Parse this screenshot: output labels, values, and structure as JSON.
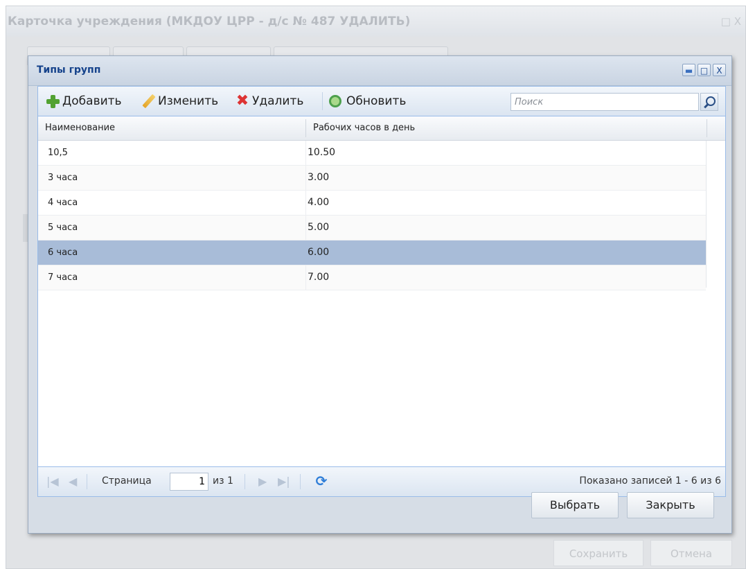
{
  "background_window": {
    "title": "Карточка учреждения (МКДОУ ЦРР - д/с № 487 УДАЛИТЬ)",
    "controls": "□ X",
    "save_label": "Сохранить",
    "cancel_label": "Отмена"
  },
  "dialog": {
    "title": "Типы групп",
    "window_controls": {
      "minimize": "▬",
      "maximize": "□",
      "close": "X"
    }
  },
  "toolbar": {
    "add_label": "Добавить",
    "edit_label": "Изменить",
    "delete_label": "Удалить",
    "refresh_label": "Обновить",
    "search_placeholder": "Поиск"
  },
  "grid": {
    "columns": [
      "Наименование",
      "Рабочих часов в день"
    ],
    "rows": [
      {
        "name": "10,5",
        "hours": "10.50"
      },
      {
        "name": "3 часа",
        "hours": "3.00"
      },
      {
        "name": "4 часа",
        "hours": "4.00"
      },
      {
        "name": "5 часа",
        "hours": "5.00"
      },
      {
        "name": "6 часа",
        "hours": "6.00",
        "selected": true
      },
      {
        "name": "7 часа",
        "hours": "7.00"
      }
    ]
  },
  "pager": {
    "first": "|◀",
    "prev": "◀",
    "page_label": "Страница",
    "page_value": "1",
    "of_label": "из 1",
    "next": "▶",
    "last": "▶|",
    "refresh": "⟳",
    "info": "Показано записей 1 - 6 из 6"
  },
  "buttons": {
    "select_label": "Выбрать",
    "close_label": "Закрыть"
  },
  "colors": {
    "accent": "#15428b",
    "selected_row": "#a8bcd8",
    "add_icon": "#52a232",
    "delete_icon": "#dd3333"
  }
}
